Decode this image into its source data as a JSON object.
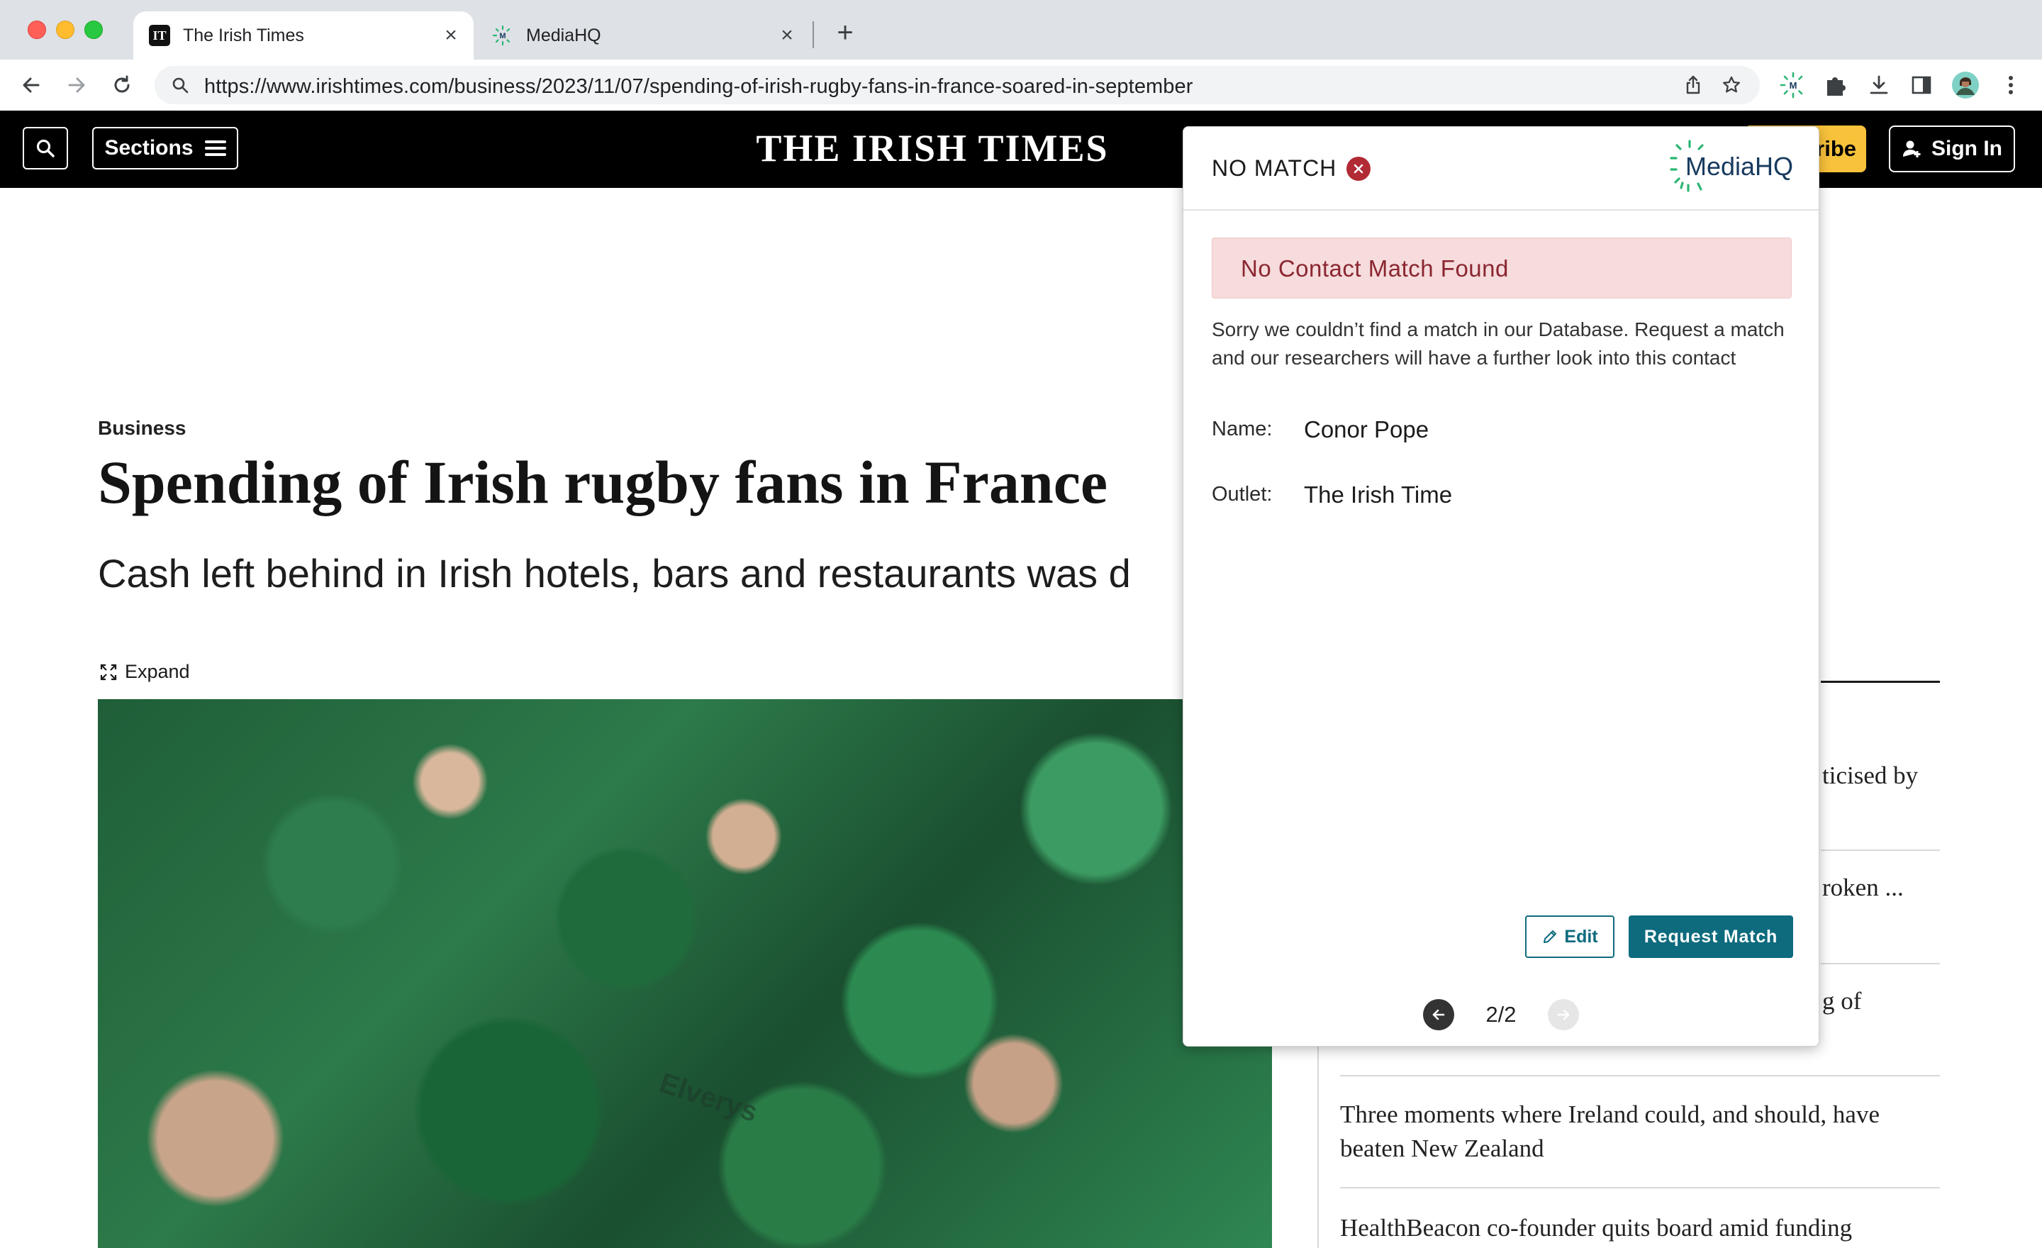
{
  "browser": {
    "tabs": [
      {
        "title": "The Irish Times",
        "favicon": "IT",
        "active": true
      },
      {
        "title": "MediaHQ",
        "favicon": "M",
        "active": false
      }
    ],
    "url": "https://www.irishtimes.com/business/2023/11/07/spending-of-irish-rugby-fans-in-france-soared-in-september"
  },
  "site": {
    "masthead": "THE IRISH TIMES",
    "sections_label": "Sections",
    "subscribe_label": "ribe",
    "signin_label": "Sign In",
    "kicker": "Business",
    "headline": "Spending of Irish rugby fans in France",
    "standfirst": "Cash left behind in Irish hotels, bars and restaurants was d",
    "expand_label": "Expand",
    "hero_text": "Elverys",
    "sidebar": {
      "frag1": "ticised by",
      "frag2": "roken ...",
      "frag3": "g of",
      "item4": "Three moments where Ireland could, and should, have beaten New Zealand",
      "item5": "HealthBeacon co-founder quits board amid funding"
    }
  },
  "popup": {
    "status": "NO MATCH",
    "logo_text": "MediaHQ",
    "alert": "No Contact Match Found",
    "message": "Sorry we couldn’t find a match in our Database. Request a match and our researchers will have a further look into this contact",
    "fields": {
      "name_label": "Name:",
      "name_value": "Conor Pope",
      "outlet_label": "Outlet:",
      "outlet_value": "The Irish Time"
    },
    "edit_label": "Edit",
    "request_label": "Request Match",
    "pager": "2/2"
  },
  "colors": {
    "accent_teal": "#0e6b7e",
    "alert_bg": "#f6dcdc",
    "alert_text": "#8b2631",
    "error_red": "#b12a34",
    "subscribe_yellow": "#f8c23b"
  }
}
